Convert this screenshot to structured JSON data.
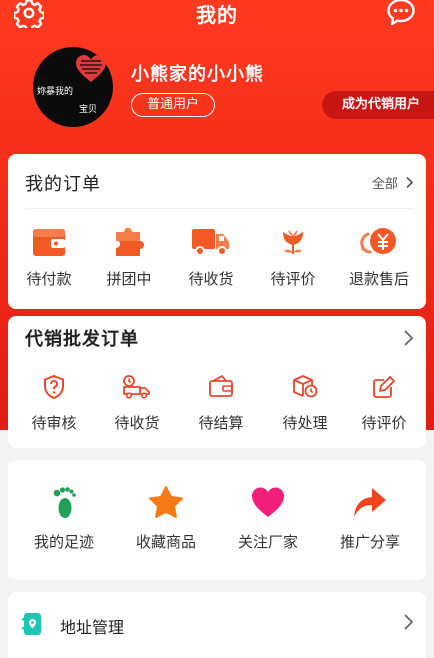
{
  "header": {
    "title": "我的",
    "left_icon": "gear-icon",
    "right_icon": "chat-bubble-icon"
  },
  "profile": {
    "avatar_text_1": "妳暴我的",
    "avatar_text_2": "宝贝",
    "username": "小熊家的小小熊",
    "badge": "普通用户",
    "become_agent": "成为代销用户"
  },
  "orders": {
    "title": "我的订单",
    "all_label": "全部",
    "items": [
      {
        "label": "待付款",
        "icon": "wallet-icon"
      },
      {
        "label": "拼团中",
        "icon": "puzzle-icon"
      },
      {
        "label": "待收货",
        "icon": "truck-icon"
      },
      {
        "label": "待评价",
        "icon": "flower-icon"
      },
      {
        "label": "退款售后",
        "icon": "refund-yen-icon"
      }
    ]
  },
  "wholesale": {
    "title": "代销批发订单",
    "items": [
      {
        "label": "待审核",
        "icon": "shield-question-icon"
      },
      {
        "label": "待收货",
        "icon": "delivery-truck-icon"
      },
      {
        "label": "待结算",
        "icon": "wallet-outline-icon"
      },
      {
        "label": "待处理",
        "icon": "box-clock-icon"
      },
      {
        "label": "待评价",
        "icon": "edit-icon"
      }
    ]
  },
  "shortcuts": {
    "items": [
      {
        "label": "我的足迹",
        "icon": "footprint-icon",
        "color": "#22a05a"
      },
      {
        "label": "收藏商品",
        "icon": "star-icon",
        "color": "#f57a16"
      },
      {
        "label": "关注厂家",
        "icon": "heart-icon",
        "color": "#f2207a"
      },
      {
        "label": "推广分享",
        "icon": "share-icon",
        "color": "#f2421e"
      }
    ]
  },
  "address": {
    "label": "地址管理",
    "icon": "address-book-icon"
  },
  "colors": {
    "brand_red": "#f02a17",
    "accent_orange": "#f15a24"
  }
}
